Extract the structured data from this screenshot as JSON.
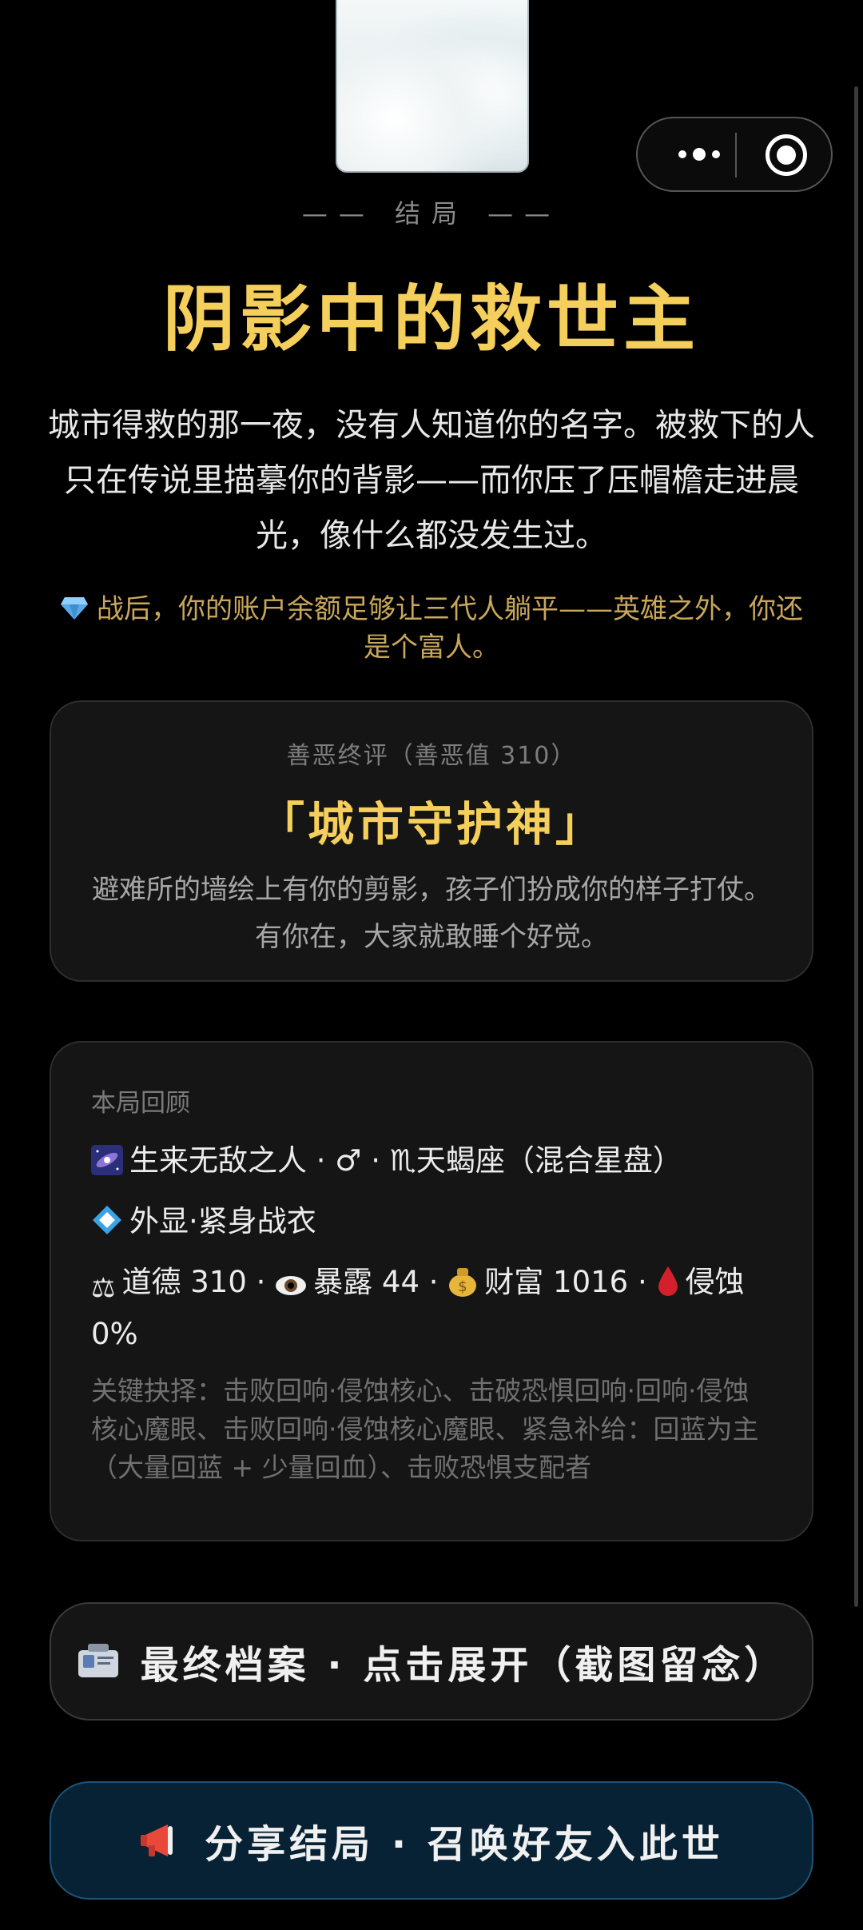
{
  "capsule": {
    "more_icon": "more-dots-icon",
    "close_icon": "target-icon"
  },
  "ending": {
    "label": "—— 结局 ——",
    "title": "阴影中的救世主",
    "story": "城市得救的那一夜，没有人知道你的名字。被救下的人只在传说里描摹你的背影——而你压了压帽檐走进晨光，像什么都没发生过。",
    "wealth_note": "战后，你的账户余额足够让三代人躺平——英雄之外，你还是个富人。",
    "wealth_icon": "gem-icon"
  },
  "verdict": {
    "subtitle": "善恶终评（善恶值 310）",
    "name": "「城市守护神」",
    "desc": "避难所的墙绘上有你的剪影，孩子们扮成你的样子打仗。有你在，大家就敢睡个好觉。"
  },
  "recap": {
    "heading": "本局回顾",
    "origin": "生来无敌之人 · ♂ · ♏天蝎座（混合星盘）",
    "appearance": "外显·紧身战衣",
    "stats_part1": "道德 310 · ",
    "stats_part2": "暴露 44 · ",
    "stats_part3": "财富 1016 · ",
    "stats_part4": "侵蚀 0%",
    "choices": "关键抉择：击败回响·侵蚀核心、击破恐惧回响·回响·侵蚀核心魔眼、击败回响·侵蚀核心魔眼、紧急补给：回蓝为主（大量回蓝 + 少量回血）、击败恐惧支配者"
  },
  "buttons": {
    "archive": "最终档案 · 点击展开（截图留念）",
    "share": "分享结局 · 召唤好友入此世"
  },
  "colors": {
    "accent_gold": "#f5cf5b",
    "share_bg": "#072235"
  }
}
